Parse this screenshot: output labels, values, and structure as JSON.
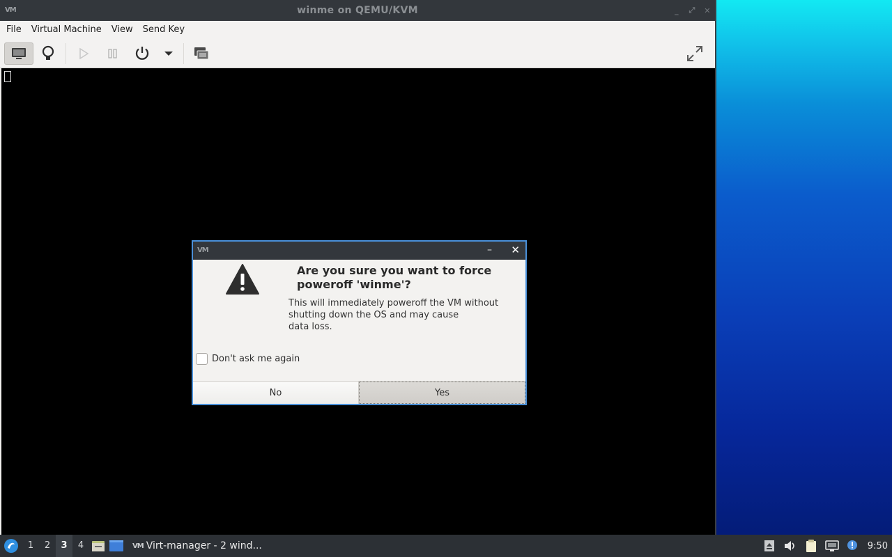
{
  "window": {
    "app_logo": "VM",
    "title": "winme on QEMU/KVM"
  },
  "menubar": {
    "items": [
      "File",
      "Virtual Machine",
      "View",
      "Send Key"
    ]
  },
  "toolbar": {
    "buttons": [
      "console-view",
      "details-view",
      "run",
      "pause",
      "power",
      "power-menu",
      "snapshots",
      "fullscreen"
    ]
  },
  "dialog": {
    "app_logo": "VM",
    "heading": "Are you sure you want to force poweroff 'winme'?",
    "body_line1": "This will immediately poweroff the VM without",
    "body_line2": "shutting down the OS and may cause",
    "body_line3": "data loss.",
    "checkbox_label": "Don't ask me again",
    "checkbox_checked": false,
    "no_label": "No",
    "yes_label": "Yes",
    "icon": "warning-icon"
  },
  "taskbar": {
    "workspaces": [
      "1",
      "2",
      "3",
      "4"
    ],
    "active_workspace": "3",
    "task_logo": "VM",
    "task_label": "Virt-manager - 2 wind...",
    "clock": "9:50"
  },
  "colors": {
    "accent": "#4a90d9",
    "titlebar": "#33373c",
    "taskbar": "#2c3035"
  }
}
